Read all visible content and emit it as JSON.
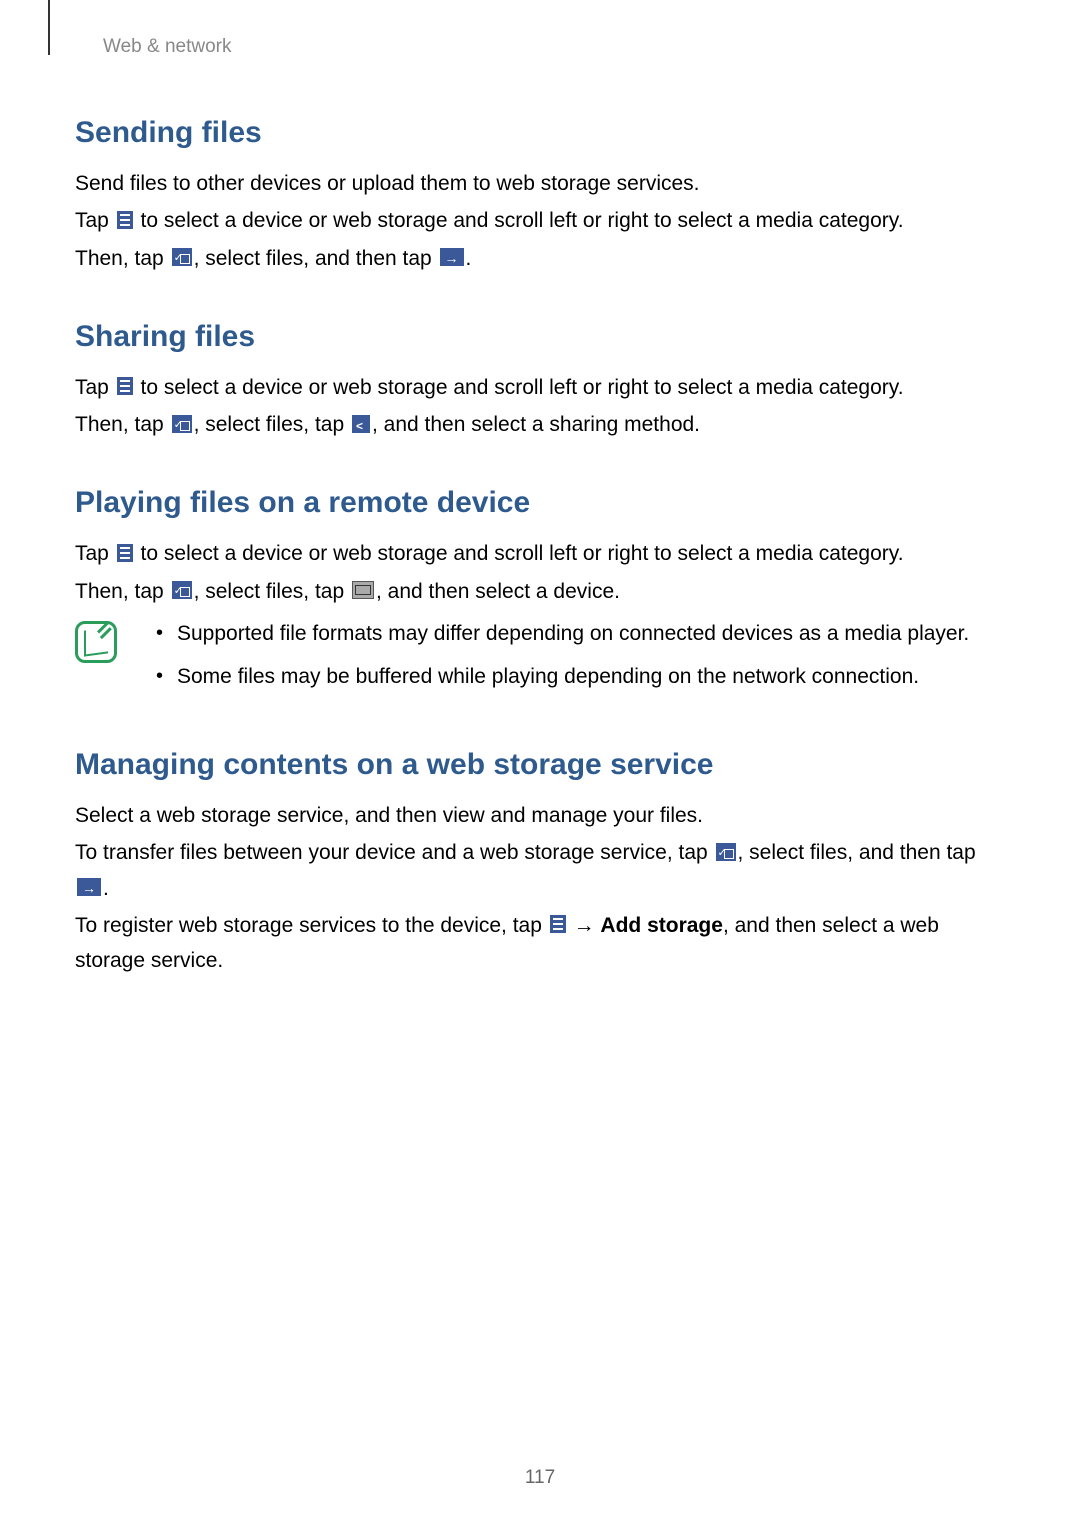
{
  "breadcrumb": "Web & network",
  "sections": {
    "sending": {
      "heading": "Sending files",
      "p1": "Send files to other devices or upload them to web storage services.",
      "p2a": "Tap ",
      "p2b": " to select a device or web storage and scroll left or right to select a media category.",
      "p3a": "Then, tap ",
      "p3b": ", select files, and then tap ",
      "p3c": "."
    },
    "sharing": {
      "heading": "Sharing files",
      "p1a": "Tap ",
      "p1b": " to select a device or web storage and scroll left or right to select a media category.",
      "p2a": "Then, tap ",
      "p2b": ", select files, tap ",
      "p2c": ", and then select a sharing method."
    },
    "playing": {
      "heading": "Playing files on a remote device",
      "p1a": "Tap ",
      "p1b": " to select a device or web storage and scroll left or right to select a media category.",
      "p2a": "Then, tap ",
      "p2b": ", select files, tap ",
      "p2c": ", and then select a device.",
      "note1": "Supported file formats may differ depending on connected devices as a media player.",
      "note2": "Some files may be buffered while playing depending on the network connection."
    },
    "managing": {
      "heading": "Managing contents on a web storage service",
      "p1": "Select a web storage service, and then view and manage your files.",
      "p2a": "To transfer files between your device and a web storage service, tap ",
      "p2b": ", select files, and then tap ",
      "p2c": ".",
      "p3a": "To register web storage services to the device, tap ",
      "p3arrow": " → ",
      "p3bold": "Add storage",
      "p3b": ", and then select a web storage service."
    }
  },
  "pageNumber": "117"
}
